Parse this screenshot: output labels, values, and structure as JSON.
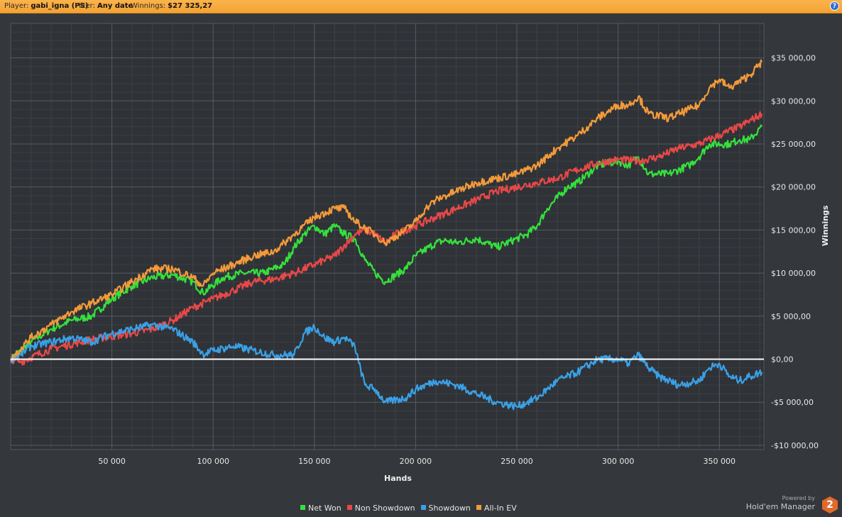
{
  "header": {
    "player_label": "Player:",
    "player_value": "gabi_igna (PS)",
    "filter_label": "Filter:",
    "filter_value": "Any date",
    "winnings_label": "Winnings:",
    "winnings_value": "$27 325,27",
    "help_icon": "question-icon",
    "help_glyph": "?"
  },
  "branding": {
    "powered_by": "Powered by",
    "product": "Hold'em Manager",
    "logo_glyph": "2"
  },
  "chart_data": {
    "type": "line",
    "xlabel": "Hands",
    "ylabel": "Winnings",
    "xlim": [
      0,
      372000
    ],
    "ylim": [
      -10500,
      39000
    ],
    "x_ticks": [
      50000,
      100000,
      150000,
      200000,
      250000,
      300000,
      350000
    ],
    "x_tick_labels": [
      "50 000",
      "100 000",
      "150 000",
      "200 000",
      "250 000",
      "300 000",
      "350 000"
    ],
    "y_ticks": [
      -10000,
      -5000,
      0,
      5000,
      10000,
      15000,
      20000,
      25000,
      30000,
      35000
    ],
    "y_tick_labels": [
      "-$10 000,00",
      "-$5 000,00",
      "$0,00",
      "$5 000,00",
      "$10 000,00",
      "$15 000,00",
      "$20 000,00",
      "$25 000,00",
      "$30 000,00",
      "$35 000,00"
    ],
    "grid": true,
    "zero_line_color": "#ffffff",
    "legend_position": "bottom",
    "series": [
      {
        "name": "Net Won",
        "color": "#35e03d",
        "points": [
          [
            0,
            0
          ],
          [
            10000,
            2000
          ],
          [
            20000,
            3500
          ],
          [
            30000,
            4500
          ],
          [
            40000,
            5000
          ],
          [
            50000,
            7000
          ],
          [
            60000,
            8500
          ],
          [
            70000,
            9500
          ],
          [
            80000,
            9800
          ],
          [
            90000,
            9000
          ],
          [
            95000,
            7700
          ],
          [
            105000,
            9500
          ],
          [
            115000,
            10000
          ],
          [
            125000,
            10000
          ],
          [
            135000,
            11000
          ],
          [
            140000,
            13000
          ],
          [
            145000,
            14500
          ],
          [
            150000,
            15500
          ],
          [
            155000,
            14500
          ],
          [
            160000,
            15500
          ],
          [
            165000,
            14500
          ],
          [
            170000,
            14000
          ],
          [
            175000,
            11500
          ],
          [
            180000,
            10000
          ],
          [
            185000,
            9000
          ],
          [
            195000,
            10500
          ],
          [
            200000,
            12000
          ],
          [
            210000,
            13500
          ],
          [
            215000,
            13800
          ],
          [
            220000,
            13500
          ],
          [
            230000,
            14000
          ],
          [
            240000,
            13000
          ],
          [
            250000,
            14000
          ],
          [
            255000,
            14500
          ],
          [
            260000,
            15500
          ],
          [
            265000,
            17500
          ],
          [
            275000,
            20000
          ],
          [
            280000,
            20500
          ],
          [
            290000,
            22500
          ],
          [
            300000,
            23000
          ],
          [
            305000,
            22500
          ],
          [
            310000,
            23500
          ],
          [
            315000,
            21500
          ],
          [
            325000,
            21500
          ],
          [
            335000,
            22500
          ],
          [
            340000,
            23500
          ],
          [
            345000,
            25000
          ],
          [
            355000,
            25000
          ],
          [
            360000,
            25500
          ],
          [
            365000,
            25500
          ],
          [
            371000,
            27000
          ]
        ]
      },
      {
        "name": "Non Showdown",
        "color": "#e84848",
        "points": [
          [
            0,
            0
          ],
          [
            5000,
            -300
          ],
          [
            20000,
            1200
          ],
          [
            40000,
            2300
          ],
          [
            60000,
            3000
          ],
          [
            70000,
            3500
          ],
          [
            80000,
            4500
          ],
          [
            90000,
            6000
          ],
          [
            100000,
            7000
          ],
          [
            110000,
            8000
          ],
          [
            120000,
            9000
          ],
          [
            130000,
            9300
          ],
          [
            140000,
            10000
          ],
          [
            150000,
            11000
          ],
          [
            160000,
            12000
          ],
          [
            170000,
            14500
          ],
          [
            175000,
            15000
          ],
          [
            180000,
            14500
          ],
          [
            185000,
            13500
          ],
          [
            190000,
            14500
          ],
          [
            200000,
            15500
          ],
          [
            210000,
            16500
          ],
          [
            220000,
            17500
          ],
          [
            230000,
            18500
          ],
          [
            240000,
            19500
          ],
          [
            250000,
            20000
          ],
          [
            260000,
            20500
          ],
          [
            270000,
            21000
          ],
          [
            280000,
            22000
          ],
          [
            290000,
            22800
          ],
          [
            300000,
            23200
          ],
          [
            310000,
            23000
          ],
          [
            320000,
            23500
          ],
          [
            330000,
            24500
          ],
          [
            340000,
            25000
          ],
          [
            350000,
            26000
          ],
          [
            360000,
            27000
          ],
          [
            371000,
            28500
          ]
        ]
      },
      {
        "name": "Showdown",
        "color": "#3aa0e6",
        "points": [
          [
            0,
            0
          ],
          [
            5000,
            500
          ],
          [
            10000,
            1500
          ],
          [
            20000,
            2000
          ],
          [
            30000,
            2500
          ],
          [
            40000,
            2000
          ],
          [
            50000,
            3000
          ],
          [
            60000,
            3500
          ],
          [
            70000,
            4000
          ],
          [
            80000,
            3500
          ],
          [
            90000,
            2000
          ],
          [
            95000,
            600
          ],
          [
            100000,
            1000
          ],
          [
            110000,
            1500
          ],
          [
            120000,
            1000
          ],
          [
            130000,
            500
          ],
          [
            140000,
            500
          ],
          [
            145000,
            3000
          ],
          [
            150000,
            3800
          ],
          [
            155000,
            2500
          ],
          [
            160000,
            2000
          ],
          [
            165000,
            2500
          ],
          [
            170000,
            1500
          ],
          [
            172000,
            -500
          ],
          [
            175000,
            -3000
          ],
          [
            180000,
            -3500
          ],
          [
            185000,
            -5000
          ],
          [
            195000,
            -4500
          ],
          [
            200000,
            -3500
          ],
          [
            210000,
            -2500
          ],
          [
            220000,
            -3000
          ],
          [
            230000,
            -4000
          ],
          [
            240000,
            -5000
          ],
          [
            250000,
            -5500
          ],
          [
            255000,
            -5000
          ],
          [
            260000,
            -4500
          ],
          [
            265000,
            -3500
          ],
          [
            270000,
            -2500
          ],
          [
            280000,
            -1500
          ],
          [
            290000,
            0
          ],
          [
            300000,
            0
          ],
          [
            305000,
            -500
          ],
          [
            310000,
            500
          ],
          [
            315000,
            -1000
          ],
          [
            320000,
            -2000
          ],
          [
            330000,
            -3000
          ],
          [
            340000,
            -2500
          ],
          [
            345000,
            -1000
          ],
          [
            350000,
            -500
          ],
          [
            355000,
            -2000
          ],
          [
            360000,
            -2500
          ],
          [
            365000,
            -2000
          ],
          [
            371000,
            -1500
          ]
        ]
      },
      {
        "name": "All-In EV",
        "color": "#f39a3a",
        "points": [
          [
            0,
            0
          ],
          [
            10000,
            2500
          ],
          [
            20000,
            4000
          ],
          [
            30000,
            5500
          ],
          [
            40000,
            6500
          ],
          [
            50000,
            7500
          ],
          [
            60000,
            9000
          ],
          [
            70000,
            10500
          ],
          [
            80000,
            10500
          ],
          [
            90000,
            9500
          ],
          [
            95000,
            8500
          ],
          [
            100000,
            10000
          ],
          [
            110000,
            11000
          ],
          [
            120000,
            12000
          ],
          [
            130000,
            12500
          ],
          [
            140000,
            14500
          ],
          [
            150000,
            16500
          ],
          [
            160000,
            17500
          ],
          [
            165000,
            17500
          ],
          [
            170000,
            16000
          ],
          [
            180000,
            14500
          ],
          [
            185000,
            13500
          ],
          [
            195000,
            15000
          ],
          [
            200000,
            16000
          ],
          [
            205000,
            17500
          ],
          [
            210000,
            18500
          ],
          [
            220000,
            19500
          ],
          [
            230000,
            20500
          ],
          [
            240000,
            21000
          ],
          [
            250000,
            21500
          ],
          [
            260000,
            22500
          ],
          [
            270000,
            24500
          ],
          [
            280000,
            26000
          ],
          [
            290000,
            28000
          ],
          [
            300000,
            29500
          ],
          [
            305000,
            29500
          ],
          [
            310000,
            30500
          ],
          [
            315000,
            28500
          ],
          [
            325000,
            28000
          ],
          [
            335000,
            29000
          ],
          [
            340000,
            29500
          ],
          [
            345000,
            31500
          ],
          [
            350000,
            32500
          ],
          [
            355000,
            31500
          ],
          [
            365000,
            33000
          ],
          [
            371000,
            34500
          ]
        ]
      }
    ]
  }
}
